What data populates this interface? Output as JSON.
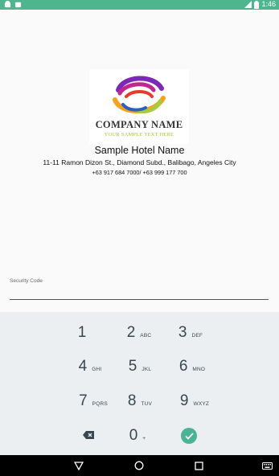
{
  "status_bar": {
    "time": "1:46",
    "bg_color": "#4fb58e",
    "icons": [
      "android-icon",
      "notification-icon",
      "signal-icon",
      "battery-icon"
    ]
  },
  "logo": {
    "company_name": "COMPANY NAME",
    "tagline": "YOUR SAMPLE TEXT HERE"
  },
  "hotel": {
    "name": "Sample Hotel Name",
    "address": "11-11 Ramon Dizon St., Diamond Subd., Balibago, Angeles City",
    "phone": "+63 917 684 7000/ +63 999 177 700"
  },
  "security": {
    "label": "Security Code",
    "value": ""
  },
  "keypad": {
    "accent_color": "#4ab394",
    "keys": [
      {
        "num": "1",
        "letters": ""
      },
      {
        "num": "2",
        "letters": "ABC"
      },
      {
        "num": "3",
        "letters": "DEF"
      },
      {
        "num": "4",
        "letters": "GHI"
      },
      {
        "num": "5",
        "letters": "JKL"
      },
      {
        "num": "6",
        "letters": "MNO"
      },
      {
        "num": "7",
        "letters": "PQRS"
      },
      {
        "num": "8",
        "letters": "TUV"
      },
      {
        "num": "9",
        "letters": "WXYZ"
      },
      {
        "num": "0",
        "letters": "+"
      }
    ],
    "backspace_icon": "backspace-icon",
    "done_icon": "check-icon"
  },
  "nav_bar": {
    "icons": [
      "back-icon",
      "home-icon",
      "recents-icon",
      "keyboard-icon"
    ]
  }
}
